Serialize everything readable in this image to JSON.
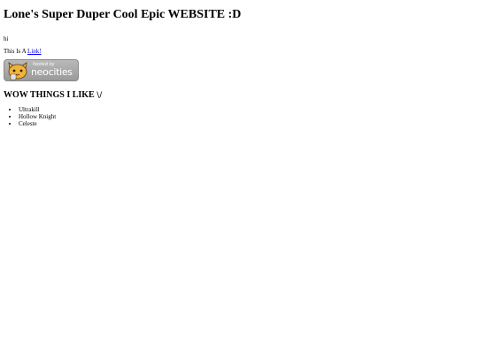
{
  "page": {
    "title": "Lone's Super Duper Cool Epic WEBSITE :D",
    "greeting": "hi",
    "link_prefix": "This Is A ",
    "link_text": "Link!",
    "badge": {
      "hosted_label": "hosted by",
      "brand": "neocities"
    },
    "likes_heading": "WOW THINGS I LIKE",
    "likes_arrow": "\\/",
    "likes": [
      "Ultrakill",
      "Hollow Knight",
      "Celeste"
    ]
  },
  "colors": {
    "link": "#0000ee",
    "badge_bg": "#a8a8a8",
    "cat": "#f0b33c"
  }
}
